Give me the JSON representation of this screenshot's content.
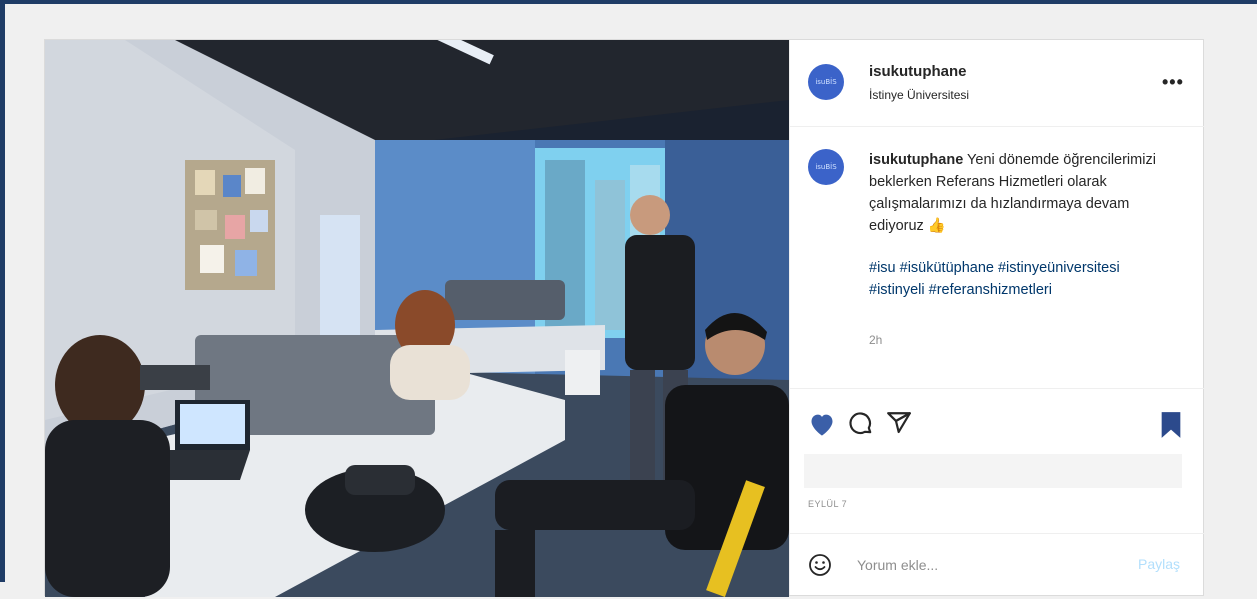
{
  "post": {
    "username": "isukutuphane",
    "location": "İstinye Üniversitesi",
    "avatar_text": "isuBİS",
    "more_glyph": "•••",
    "caption_user": "isukutuphane",
    "caption_text": "Yeni dönemde öğrencilerimizi beklerken Referans Hizmetleri olarak çalışmalarımızı da hızlandırmaya devam ediyoruz 👍",
    "hashtags": "#isu #isükütüphane #istinyeüniversitesi #istinyeli #referanshizmetleri",
    "time_ago": "2h",
    "date": "EYLÜL 7",
    "comment_placeholder": "Yorum ekle...",
    "post_button": "Paylaş"
  },
  "icons": {
    "like": "heart-icon",
    "comment": "comment-icon",
    "share": "share-icon",
    "save": "bookmark-icon",
    "emoji": "smile-icon",
    "more": "more-icon"
  },
  "colors": {
    "liked": "#3b5fa8",
    "saved": "#2c4a8c",
    "link": "#00376b",
    "post_disabled": "#b2dffc",
    "frame": "#1f3c66"
  }
}
